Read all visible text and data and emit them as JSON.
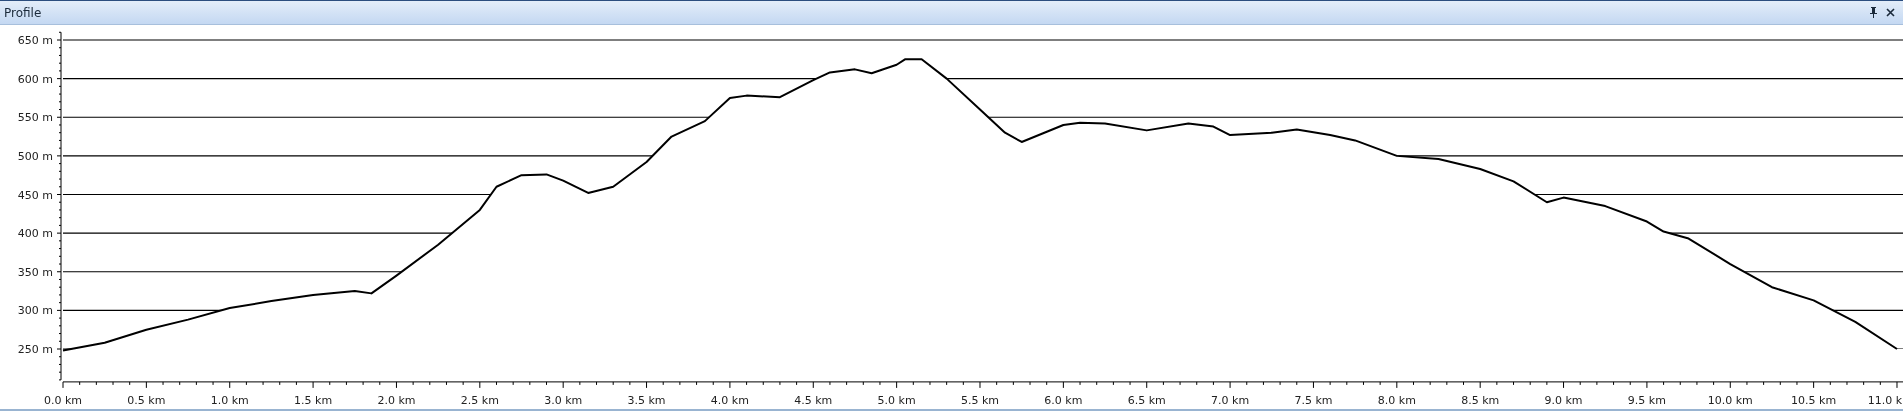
{
  "window": {
    "title": "Profile"
  },
  "chart_data": {
    "type": "line",
    "x": [
      0,
      0.25,
      0.5,
      0.75,
      1.0,
      1.25,
      1.5,
      1.75,
      1.85,
      2.0,
      2.25,
      2.5,
      2.6,
      2.75,
      2.9,
      3.0,
      3.15,
      3.3,
      3.5,
      3.65,
      3.85,
      4.0,
      4.1,
      4.3,
      4.5,
      4.6,
      4.75,
      4.85,
      5.0,
      5.05,
      5.15,
      5.3,
      5.5,
      5.65,
      5.75,
      6.0,
      6.1,
      6.25,
      6.5,
      6.75,
      6.9,
      7.0,
      7.25,
      7.4,
      7.6,
      7.75,
      8.0,
      8.25,
      8.5,
      8.7,
      8.9,
      9.0,
      9.25,
      9.5,
      9.6,
      9.75,
      10.0,
      10.25,
      10.5,
      10.75,
      11.0
    ],
    "series": [
      {
        "color": "#000000",
        "values": [
          248,
          258,
          275,
          288,
          303,
          312,
          320,
          325,
          322,
          345,
          385,
          430,
          460,
          475,
          476,
          468,
          452,
          460,
          492,
          525,
          545,
          575,
          578,
          576,
          598,
          608,
          612,
          607,
          618,
          625,
          625,
          600,
          560,
          530,
          518,
          540,
          543,
          542,
          533,
          542,
          538,
          527,
          530,
          534,
          527,
          520,
          500,
          496,
          483,
          467,
          440,
          446,
          435,
          415,
          402,
          393,
          360,
          330,
          313,
          285,
          250
        ]
      }
    ],
    "xlim": [
      0,
      11.036
    ],
    "grid": true,
    "ylim": [
      210,
      660
    ],
    "xticks": [
      {
        "value": 0,
        "label": "0.0 km"
      },
      {
        "value": 0.5,
        "label": "0.5 km"
      },
      {
        "value": 1,
        "label": "1.0 km"
      },
      {
        "value": 1.5,
        "label": "1.5 km"
      },
      {
        "value": 2,
        "label": "2.0 km"
      },
      {
        "value": 2.5,
        "label": "2.5 km"
      },
      {
        "value": 3,
        "label": "3.0 km"
      },
      {
        "value": 3.5,
        "label": "3.5 km"
      },
      {
        "value": 4,
        "label": "4.0 km"
      },
      {
        "value": 4.5,
        "label": "4.5 km"
      },
      {
        "value": 5,
        "label": "5.0 km"
      },
      {
        "value": 5.5,
        "label": "5.5 km"
      },
      {
        "value": 6,
        "label": "6.0 km"
      },
      {
        "value": 6.5,
        "label": "6.5 km"
      },
      {
        "value": 7,
        "label": "7.0 km"
      },
      {
        "value": 7.5,
        "label": "7.5 km"
      },
      {
        "value": 8,
        "label": "8.0 km"
      },
      {
        "value": 8.5,
        "label": "8.5 km"
      },
      {
        "value": 9,
        "label": "9.0 km"
      },
      {
        "value": 9.5,
        "label": "9.5 km"
      },
      {
        "value": 10,
        "label": "10.0 km"
      },
      {
        "value": 10.5,
        "label": "10.5 km"
      },
      {
        "value": 11,
        "label": "11.0 k"
      }
    ],
    "yticks": [
      {
        "value": 250,
        "label": "250 m"
      },
      {
        "value": 300,
        "label": "300 m"
      },
      {
        "value": 350,
        "label": "350 m"
      },
      {
        "value": 400,
        "label": "400 m"
      },
      {
        "value": 450,
        "label": "450 m"
      },
      {
        "value": 500,
        "label": "500 m"
      },
      {
        "value": 550,
        "label": "550 m"
      },
      {
        "value": 600,
        "label": "600 m"
      },
      {
        "value": 650,
        "label": "650 m"
      }
    ]
  }
}
